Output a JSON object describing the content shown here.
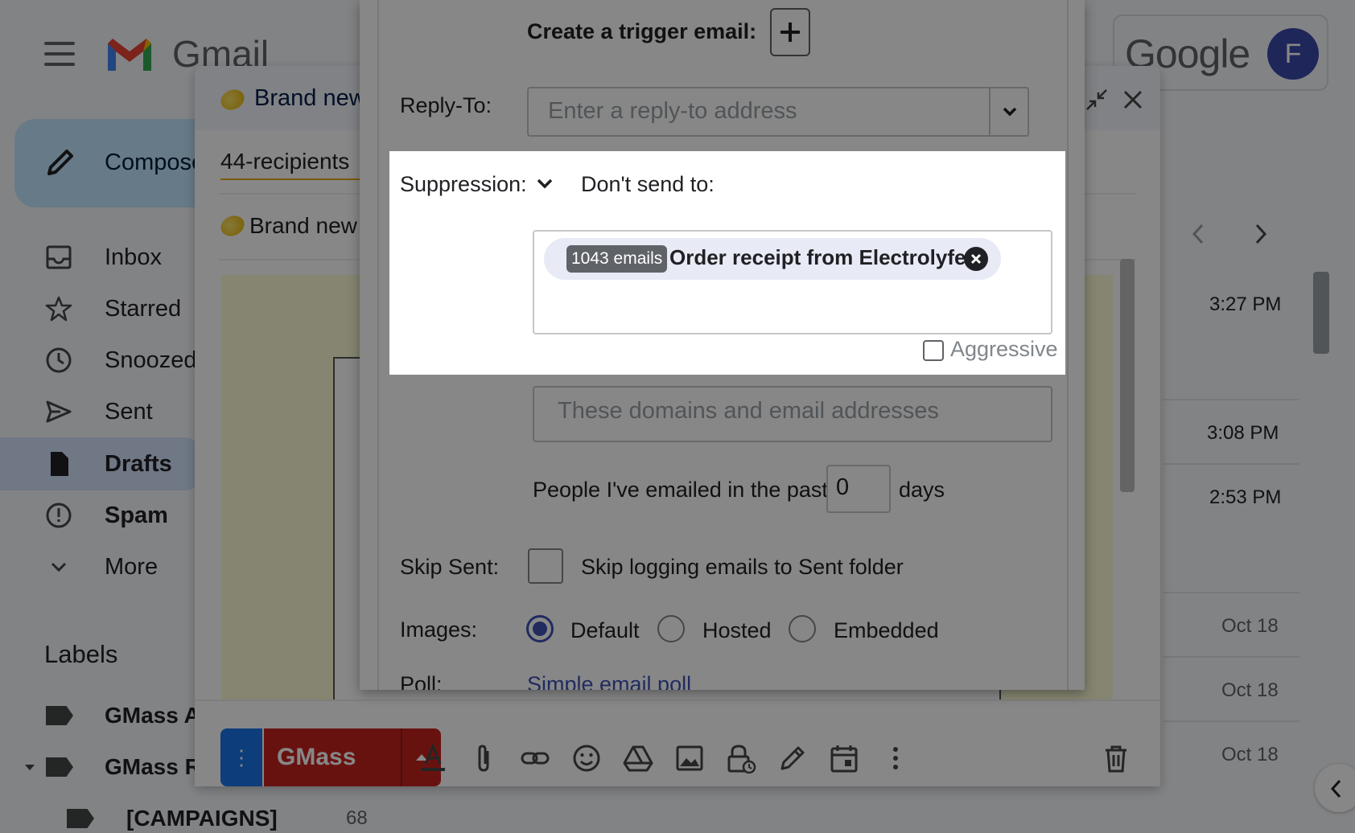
{
  "gmail": {
    "app_name": "Gmail",
    "brand": "Google",
    "avatar_initial": "F",
    "compose_label": "Compose",
    "nav": [
      {
        "label": "Inbox",
        "icon": "inbox-icon"
      },
      {
        "label": "Starred",
        "icon": "star-icon"
      },
      {
        "label": "Snoozed",
        "icon": "clock-icon"
      },
      {
        "label": "Sent",
        "icon": "send-icon"
      },
      {
        "label": "Drafts",
        "icon": "draft-icon"
      },
      {
        "label": "Spam",
        "icon": "spam-icon"
      },
      {
        "label": "More",
        "icon": "chevron-down-icon"
      }
    ],
    "labels_heading": "Labels",
    "labels": [
      {
        "label": "GMass A"
      },
      {
        "label": "GMass R"
      },
      {
        "label": "[CAMPAIGNS]",
        "count": "68"
      }
    ],
    "times": [
      "3:27 PM",
      "3:08 PM",
      "2:53 PM",
      "Oct 18",
      "Oct 18",
      "Oct 18"
    ]
  },
  "compose": {
    "title": "Brand new",
    "to": "44-recipients",
    "subject": "Brand new",
    "gmass_button": "GMass",
    "more_button": "⋮"
  },
  "settings": {
    "trigger_label": "Create a trigger email:",
    "reply_to_label": "Reply-To:",
    "reply_to_placeholder": "Enter a reply-to address",
    "suppression_label": "Suppression:",
    "dont_send_label": "Don't send to:",
    "chip_count": "1043 emails",
    "chip_text": "Order receipt from Electrolyfe",
    "aggressive_label": "Aggressive",
    "domains_placeholder": "These domains and email addresses",
    "past_label": "People I've emailed in the past",
    "past_days_value": "0",
    "days_label": "days",
    "skip_sent_label": "Skip Sent:",
    "skip_sent_text": "Skip logging emails to Sent folder",
    "images_label": "Images:",
    "images_options": [
      "Default",
      "Hosted",
      "Embedded"
    ],
    "images_selected": "Default",
    "poll_label": "Poll:",
    "poll_link": "Simple email poll"
  },
  "colors": {
    "accent": "#3f51b5",
    "gmass_red": "#c5221f",
    "blue_button": "#1a73e8"
  }
}
